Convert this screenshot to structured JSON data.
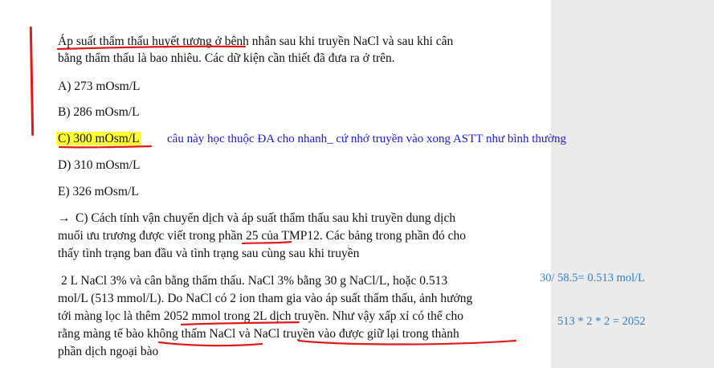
{
  "question": {
    "line1": "Áp suất thẩm thấu huyết tương ở bệnh nhân sau khi truyền NaCl và sau khi cân",
    "line2": "bằng thẩm thấu là bao nhiêu. Các dữ kiện cần thiết đã đưa ra ở trên."
  },
  "options": [
    {
      "label": "A) 273 mOsm/L"
    },
    {
      "label": "B) 286 mOsm/L"
    },
    {
      "label": "C) 300 mOsm/L",
      "highlighted": true
    },
    {
      "label": "D) 310 mOsm/L"
    },
    {
      "label": "E) 326 mOsm/L"
    }
  ],
  "note": "câu này học thuộc ĐA cho nhanh_ cứ nhớ truyền vào xong ASTT như bình thường",
  "explanation": {
    "p1_line1": "C) Cách tính vận chuyển dịch và áp suất thẩm thấu sau khi truyền dung dịch",
    "p1_line2": "muối ưu trương được viết trong phần 25 của TMP12. Các bảng trong phần đó cho",
    "p1_line3": "thấy tình trạng ban đầu và tình trạng sau cùng sau khi truyền",
    "p2_line1": "2 L NaCl 3% và cân bằng thẩm thấu. NaCl 3% bằng 30 g NaCl/L, hoặc 0.513",
    "p2_line2": "mol/L (513 mmol/L). Do NaCl có 2 ion tham gia vào áp suất thẩm thấu, ảnh hưởng",
    "p2_line3": "tới màng lọc là thêm 2052 mmol trong 2L dịch truyền. Như vậy xấp xỉ có thể cho",
    "p2_line4": "rằng màng tế bào không thấm NaCl và NaCl truyền vào được giữ lại trong thành",
    "p2_line5": "phần dịch  ngoại bào"
  },
  "margin_calcs": {
    "calc1": "30/ 58.5= 0.513 mol/L",
    "calc2": "513 * 2 * 2 = 2052"
  },
  "colors": {
    "ink_red": "#e11b1b",
    "highlight": "#ffff33",
    "note_blue": "#1a1ad6",
    "calc_blue": "#2f7fc4"
  }
}
